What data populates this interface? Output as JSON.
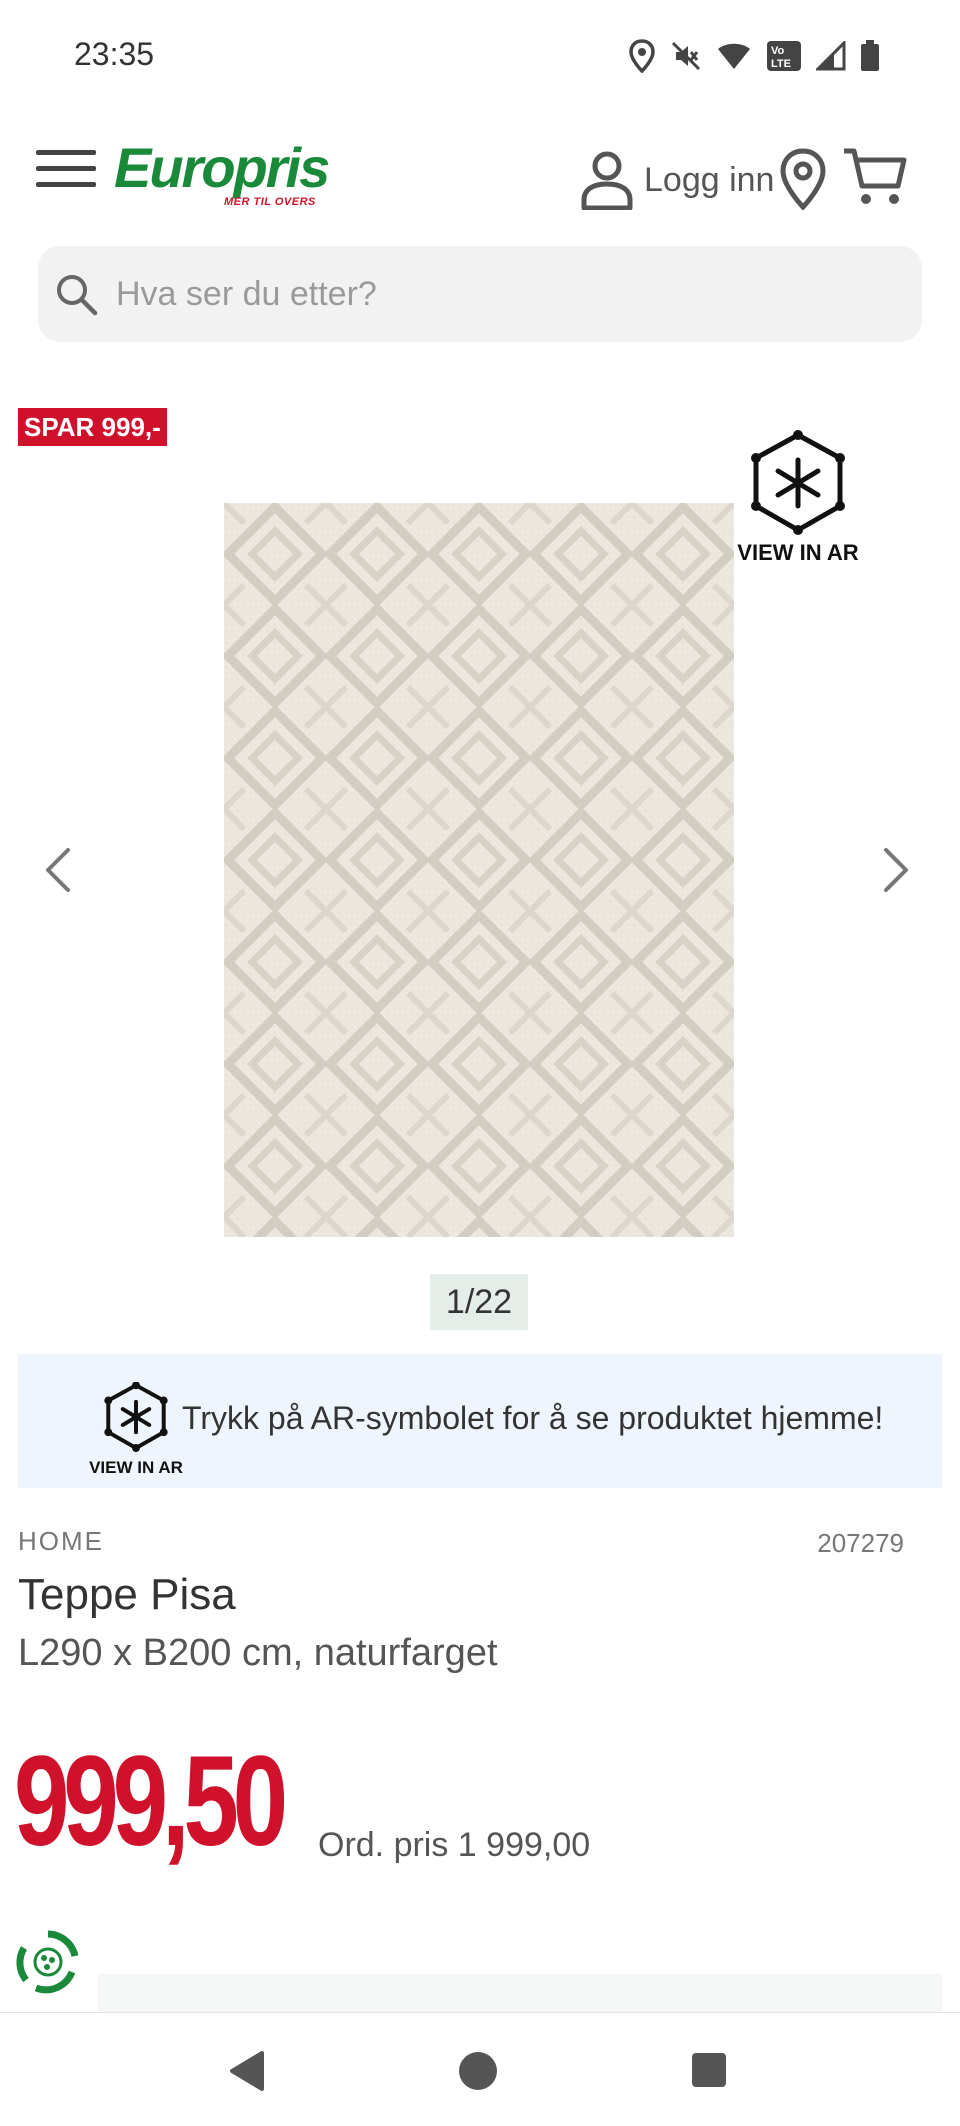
{
  "status_bar": {
    "time": "23:35",
    "icons": [
      "location-icon",
      "mute-icon",
      "wifi-icon",
      "volte-icon",
      "signal-icon",
      "battery-icon"
    ]
  },
  "header": {
    "logo_text": "Europris",
    "logo_tagline": "MER TIL OVERS",
    "login_label": "Logg inn",
    "brand_green": "#1a8a3a",
    "brand_red": "#d0112b"
  },
  "search": {
    "placeholder": "Hva ser du etter?"
  },
  "gallery": {
    "sale_badge": "SPAR 999,-",
    "ar_label": "VIEW IN AR",
    "counter": "1/22",
    "current_image": 1,
    "total_images": 22
  },
  "ar_banner": {
    "icon_label": "VIEW IN AR",
    "text": "Trykk på AR-symbolet for å se produktet hjemme!"
  },
  "product": {
    "brand": "HOME",
    "sku": "207279",
    "title": "Teppe Pisa",
    "variant": "L290 x B200 cm, naturfarget",
    "price": "999,50",
    "ordinary_price": "Ord. pris 1 999,00"
  },
  "nav_bar": {
    "buttons": [
      "back-icon",
      "home-icon",
      "recents-icon"
    ]
  }
}
